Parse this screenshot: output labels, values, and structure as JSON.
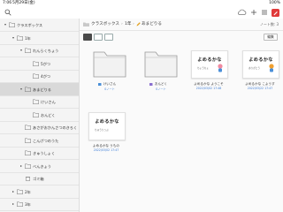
{
  "status": {
    "time": "7:06",
    "date": "5月29日(金)",
    "indicators": "100%"
  },
  "topbar": {
    "icons": [
      "search-icon",
      "cloud-icon",
      "plus-icon",
      "menu-icon",
      "pen-red-icon"
    ]
  },
  "sidebar": {
    "rows": [
      {
        "label": "クラスボックス",
        "level": 0,
        "chevron": "down"
      },
      {
        "label": "1年",
        "level": 1,
        "chevron": "down"
      },
      {
        "label": "れんらくちょう",
        "level": 2,
        "chevron": "down"
      },
      {
        "label": "5がつ",
        "level": 3,
        "chevron": ""
      },
      {
        "label": "4がつ",
        "level": 3,
        "chevron": ""
      },
      {
        "label": "あまどりる",
        "level": 2,
        "chevron": "down",
        "selected": true
      },
      {
        "label": "けいさん",
        "level": 3,
        "chevron": ""
      },
      {
        "label": "おんどく",
        "level": 3,
        "chevron": ""
      },
      {
        "label": "あさがおかんさつのきろく",
        "level": 2,
        "chevron": ""
      },
      {
        "label": "こんげつのうた",
        "level": 2,
        "chevron": ""
      },
      {
        "label": "きゅうしょく",
        "level": 2,
        "chevron": ""
      },
      {
        "label": "べんきょう",
        "level": 2,
        "chevron": "right"
      },
      {
        "label": "ゴミ箱",
        "level": 2,
        "chevron": ""
      },
      {
        "label": "2年",
        "level": 1,
        "chevron": "right"
      },
      {
        "label": "3年",
        "level": 1,
        "chevron": "right"
      }
    ]
  },
  "breadcrumb": {
    "root": "クラスボックス",
    "mid": "1年",
    "current": "あまどりる",
    "count": "ノート数: 3"
  },
  "toolbar": {
    "edit_label": "編集"
  },
  "tiles": [
    {
      "type": "folder",
      "name": "けいさん",
      "meta": "0ノート",
      "meta2": ""
    },
    {
      "type": "folder",
      "name": "おんどく",
      "meta": "0ノート",
      "meta2": ""
    },
    {
      "type": "note",
      "card_title": "よめるかな",
      "card_sub": "ちょうちょ",
      "name": "よめるかな ようこそ",
      "meta": "2022/03/02 17:48",
      "meta2": "",
      "char": "pink"
    },
    {
      "type": "note",
      "card_title": "よめるかな",
      "card_sub": "ありがとう",
      "name": "よめるかな こようす",
      "meta": "2022/03/22 17:47",
      "meta2": "",
      "char": "orange"
    },
    {
      "type": "note",
      "card_title": "よめるかな",
      "card_sub": "ちゅうりっぷ",
      "name": "よめるかな うもの",
      "meta": "2022/03/02 17:47",
      "meta2": "",
      "char": "none"
    }
  ],
  "colors": {
    "accent": "#3a7bd5",
    "folder": "#d3d3d3",
    "selected": "#d9d9d9"
  }
}
